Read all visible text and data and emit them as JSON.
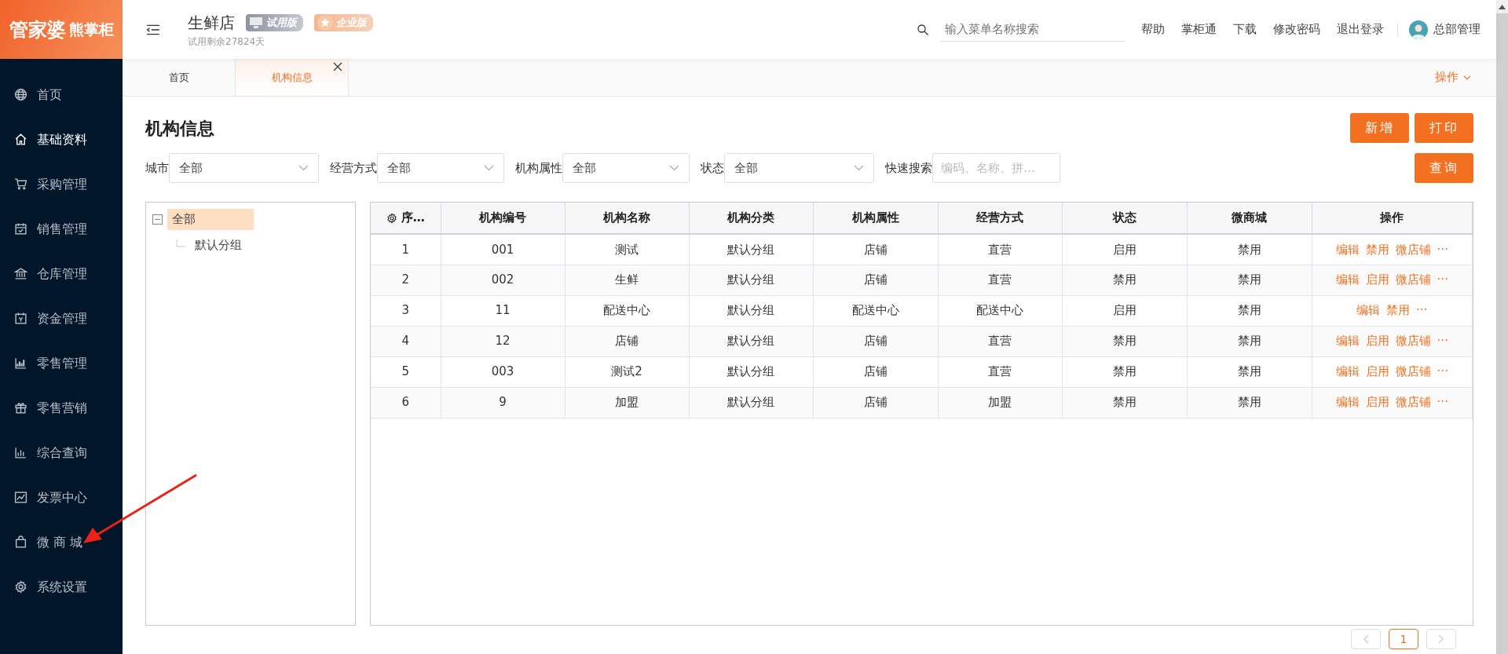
{
  "logo": {
    "brand": "管家婆",
    "product": "熊掌柜"
  },
  "sidebar": {
    "items": [
      {
        "label": "首页",
        "selected": false
      },
      {
        "label": "基础资料",
        "selected": true
      },
      {
        "label": "采购管理",
        "selected": false
      },
      {
        "label": "销售管理",
        "selected": false
      },
      {
        "label": "仓库管理",
        "selected": false
      },
      {
        "label": "资金管理",
        "selected": false
      },
      {
        "label": "零售管理",
        "selected": false
      },
      {
        "label": "零售营销",
        "selected": false
      },
      {
        "label": "综合查询",
        "selected": false
      },
      {
        "label": "发票中心",
        "selected": false
      },
      {
        "label": "微 商 城",
        "selected": false
      },
      {
        "label": "系统设置",
        "selected": false
      }
    ]
  },
  "header": {
    "store": "生鲜店",
    "badges": [
      {
        "kind": "trial",
        "label": "试用版"
      },
      {
        "kind": "enterprise",
        "label": "企业版"
      }
    ],
    "trial_note": "试用剩余27824天",
    "search": {
      "placeholder": "输入菜单名称搜索"
    },
    "links": [
      "帮助",
      "掌柜通",
      "下载",
      "修改密码",
      "退出登录"
    ],
    "user": "总部管理"
  },
  "tabs": [
    {
      "label": "首页",
      "selected": false,
      "closable": false
    },
    {
      "label": "机构信息",
      "selected": true,
      "closable": true
    }
  ],
  "tab_menu": "操作",
  "page": {
    "title": "机构信息",
    "buttons": [
      "新增",
      "打印"
    ],
    "filters": [
      {
        "kind": "select",
        "label": "城市",
        "value": "全部"
      },
      {
        "kind": "select",
        "label": "经营方式",
        "value": "全部"
      },
      {
        "kind": "select",
        "label": "机构属性",
        "value": "全部"
      },
      {
        "kind": "select",
        "label": "状态",
        "value": "全部"
      },
      {
        "kind": "text",
        "label": "快速搜索",
        "placeholder": "编码、名称、拼…"
      }
    ],
    "query_button": "查询"
  },
  "tree": {
    "items": [
      {
        "label": "全部",
        "selected": true,
        "expanded": true,
        "children": [
          {
            "label": "默认分组",
            "selected": false
          }
        ]
      }
    ]
  },
  "table": {
    "columns": [
      "序…",
      "机构编号",
      "机构名称",
      "机构分类",
      "机构属性",
      "经营方式",
      "状态",
      "微商城",
      "操作"
    ],
    "rows": [
      {
        "cells": [
          "1",
          "001",
          "测试",
          "默认分组",
          "店铺",
          "直营",
          "启用",
          "禁用"
        ],
        "actions": [
          "编辑",
          "禁用",
          "微店铺",
          "···"
        ]
      },
      {
        "cells": [
          "2",
          "002",
          "生鲜",
          "默认分组",
          "店铺",
          "直营",
          "禁用",
          "禁用"
        ],
        "actions": [
          "编辑",
          "启用",
          "微店铺",
          "···"
        ]
      },
      {
        "cells": [
          "3",
          "11",
          "配送中心",
          "默认分组",
          "配送中心",
          "配送中心",
          "启用",
          "禁用"
        ],
        "actions": [
          "编辑",
          "禁用",
          "···"
        ]
      },
      {
        "cells": [
          "4",
          "12",
          "店铺",
          "默认分组",
          "店铺",
          "直营",
          "禁用",
          "禁用"
        ],
        "actions": [
          "编辑",
          "启用",
          "微店铺",
          "···"
        ]
      },
      {
        "cells": [
          "5",
          "003",
          "测试2",
          "默认分组",
          "店铺",
          "直营",
          "禁用",
          "禁用"
        ],
        "actions": [
          "编辑",
          "启用",
          "微店铺",
          "···"
        ]
      },
      {
        "cells": [
          "6",
          "9",
          "加盟",
          "默认分组",
          "店铺",
          "加盟",
          "禁用",
          "禁用"
        ],
        "actions": [
          "编辑",
          "启用",
          "微店铺",
          "···"
        ]
      }
    ]
  },
  "pagination": {
    "pages": [
      {
        "label": "1",
        "selected": true
      }
    ]
  }
}
